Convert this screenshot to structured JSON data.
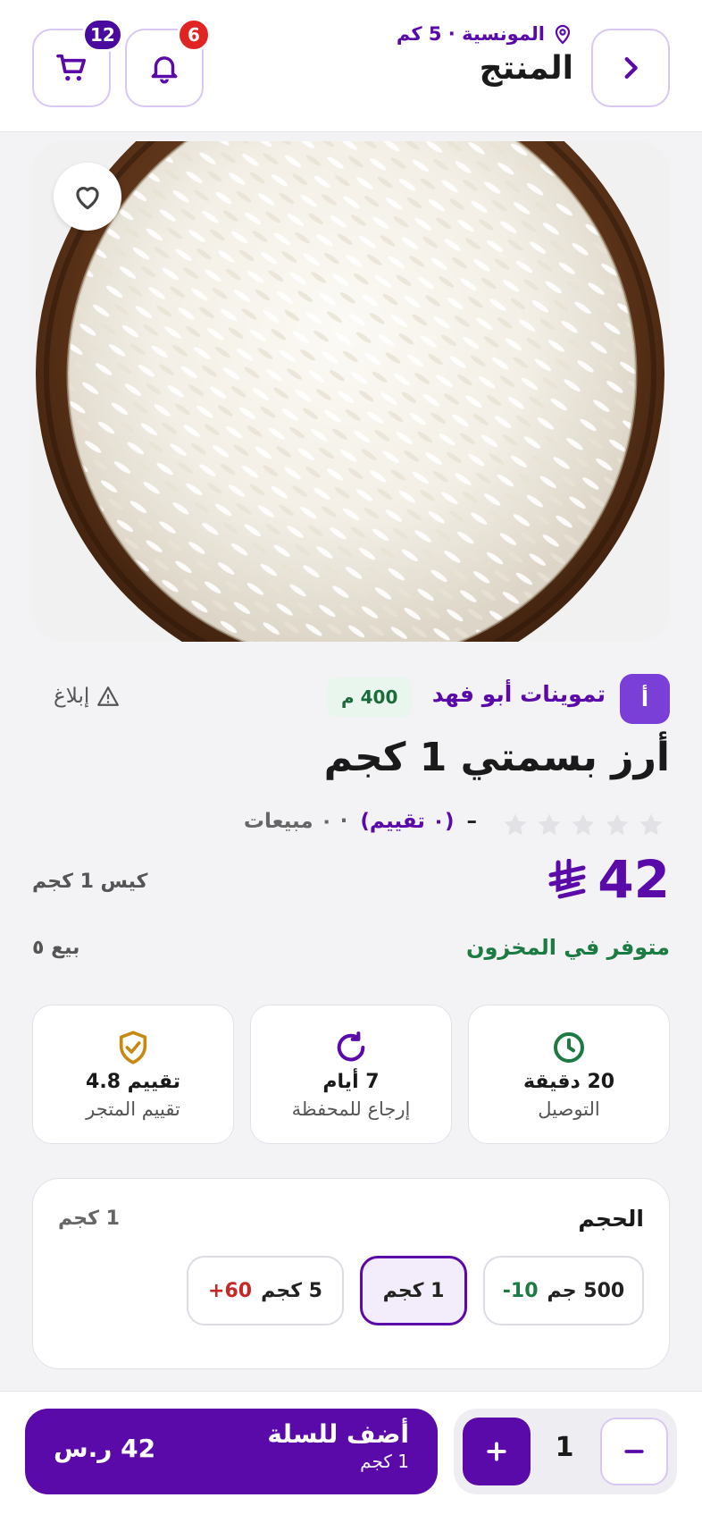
{
  "header": {
    "title": "المنتج",
    "location": "المونسية · 5 كم",
    "notifications_count": "6",
    "cart_count": "12"
  },
  "store": {
    "initial": "أ",
    "name": "تموينات أبو فهد",
    "distance": "400 م",
    "report_label": "إبلاغ"
  },
  "product": {
    "name": "أرز بسمتي 1 كجم",
    "rating_dash": "–",
    "reviews": "(٠ تقييم)",
    "sales": "· ٠ مبيعات",
    "price": "42",
    "unit": "كيس 1 كجم",
    "stock_status": "متوفر في المخزون",
    "sold": "بيع ٥",
    "rating_stars": 0
  },
  "info_cards": [
    {
      "icon": "clock-icon",
      "value": "20 دقيقة",
      "label": "التوصيل"
    },
    {
      "icon": "refresh-icon",
      "value": "7 أيام",
      "label": "إرجاع للمحفظة"
    },
    {
      "icon": "shield-check-icon",
      "value": "تقييم 4.8",
      "label": "تقييم المتجر"
    }
  ],
  "size": {
    "title": "الحجم",
    "selected_value": "1 كجم",
    "options": [
      {
        "label": "500 جم",
        "delta": "-10",
        "delta_color": "#1c7a43"
      },
      {
        "label": "1 كجم",
        "delta": "",
        "delta_color": ""
      },
      {
        "label": "5 كجم",
        "delta": "+60",
        "delta_color": "#c62828"
      }
    ]
  },
  "cart_bar": {
    "add_label": "أضف للسلة",
    "add_sublabel": "1 كجم",
    "total": "42 ر.س",
    "quantity": "1"
  },
  "colors": {
    "brand": "#5a0aa8",
    "green": "#1c7a43",
    "red_badge": "#e02424",
    "gold": "#c68a12"
  }
}
